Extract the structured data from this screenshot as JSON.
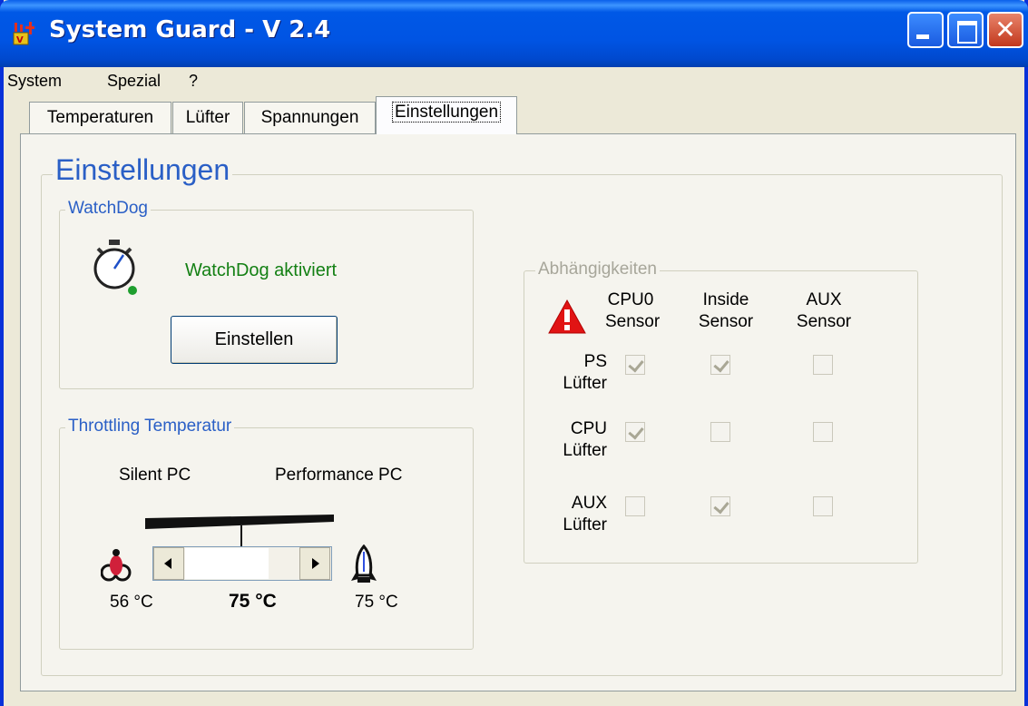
{
  "window": {
    "title": "System Guard - V 2.4",
    "close_glyph": "✕"
  },
  "menu": [
    "System",
    "Spezial",
    "?"
  ],
  "tabs": [
    {
      "label": "Temperaturen",
      "active": false
    },
    {
      "label": "Lüfter",
      "active": false
    },
    {
      "label": "Spannungen",
      "active": false
    },
    {
      "label": "Einstellungen",
      "active": true
    }
  ],
  "panel": {
    "title": "Einstellungen",
    "watchdog": {
      "title": "WatchDog",
      "status": "WatchDog aktiviert",
      "button": "Einstellen",
      "icon": "stopwatch-icon"
    },
    "throttling": {
      "title": "Throttling Temperatur",
      "left_label": "Silent PC",
      "right_label": "Performance PC",
      "min_temp": "56 °C",
      "current_temp": "75 °C",
      "max_temp": "75 °C",
      "slider_level_fraction": 0.0,
      "left_icon": "bicycle-icon",
      "right_icon": "rocket-icon"
    },
    "dependencies": {
      "title": "Abhängigkeiten",
      "columns": [
        {
          "line1": "CPU0",
          "line2": "Sensor"
        },
        {
          "line1": "Inside",
          "line2": "Sensor"
        },
        {
          "line1": "AUX",
          "line2": "Sensor"
        }
      ],
      "rows": [
        {
          "line1": "PS",
          "line2": "Lüfter",
          "checks": [
            true,
            true,
            false
          ]
        },
        {
          "line1": "CPU",
          "line2": "Lüfter",
          "checks": [
            true,
            false,
            false
          ]
        },
        {
          "line1": "AUX",
          "line2": "Lüfter",
          "checks": [
            false,
            true,
            false
          ]
        }
      ],
      "warning_icon": "warning-icon"
    }
  },
  "colors": {
    "titlebar": "#0054E3",
    "status_green": "#148014",
    "group_title_blue": "#2A5FC6"
  }
}
